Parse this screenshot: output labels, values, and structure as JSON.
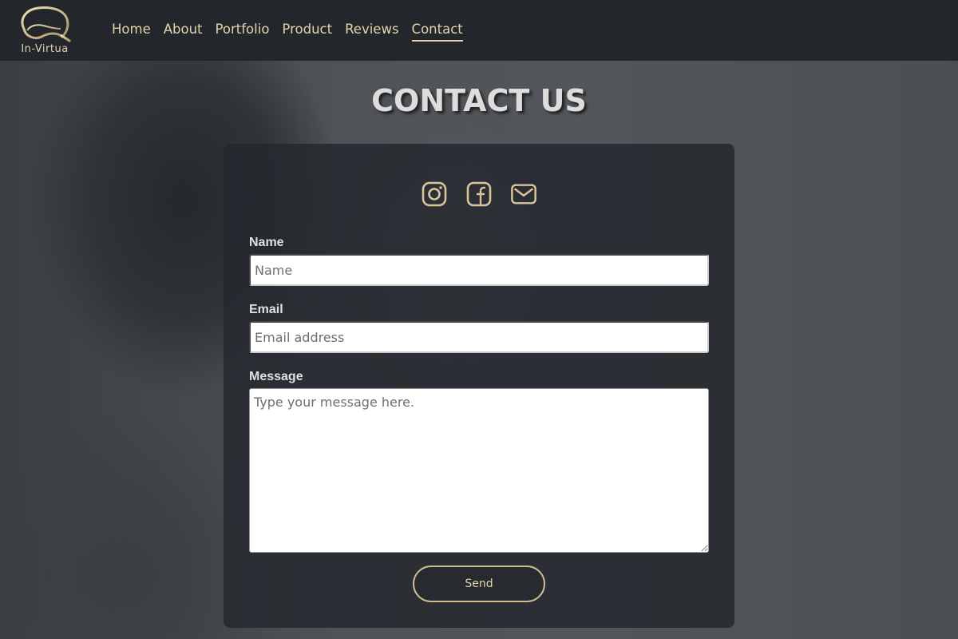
{
  "brand": {
    "logo_text": "In-Virtua"
  },
  "nav": {
    "items": [
      "Home",
      "About",
      "Portfolio",
      "Product",
      "Reviews",
      "Contact"
    ],
    "active": "Contact"
  },
  "page_title": "CONTACT US",
  "social": {
    "icons": [
      "instagram-icon",
      "facebook-icon",
      "mail-icon"
    ]
  },
  "form": {
    "name_label": "Name",
    "name_placeholder": "Name",
    "name_value": "",
    "email_label": "Email",
    "email_placeholder": "Email address",
    "email_value": "",
    "message_label": "Message",
    "message_placeholder": "Type your message here.",
    "message_value": "",
    "send_label": "Send"
  },
  "colors": {
    "accent": "#e2d3ac",
    "header_bg": "#23272c",
    "card_bg": "#25292e"
  }
}
